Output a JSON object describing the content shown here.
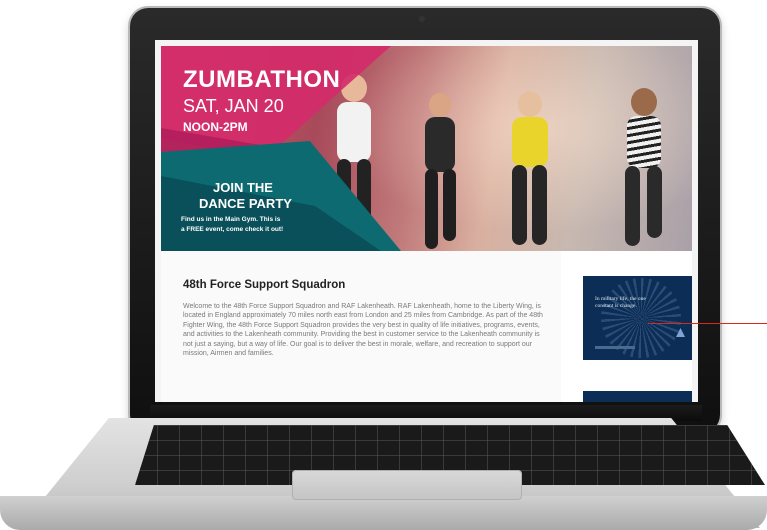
{
  "hero": {
    "title": "ZUMBATHON",
    "date": "SAT, JAN 20",
    "time": "NOON-2PM",
    "join_line1": "JOIN THE",
    "join_line2": "DANCE PARTY",
    "find_line1": "Find us in the Main Gym. This is",
    "find_line2": "a FREE event, come check it out!"
  },
  "section": {
    "title": "48th Force Support Squadron",
    "body": "Welcome to the 48th Force Support Squadron and RAF Lakenheath. RAF Lakenheath, home to the Liberty Wing, is located in England approximately 70 miles north east from London and 25 miles from Cambridge. As part of the 48th Fighter Wing, the 48th Force Support Squadron provides the very best in quality of life initiatives, programs, events, and activities to the Lakenheath community. Providing the best in customer service to the Lakenheath community is not just a saying, but a way of life. Our goal is to deliver the best in morale, welfare, and recreation to support our mission, Airmen and families."
  },
  "ad": {
    "line1": "In military life, the one",
    "line2": "constant is change."
  },
  "colors": {
    "pink": "#d42b6a",
    "teal": "#0d6a70",
    "navy": "#0c2d55",
    "pointer": "#d9291b"
  }
}
